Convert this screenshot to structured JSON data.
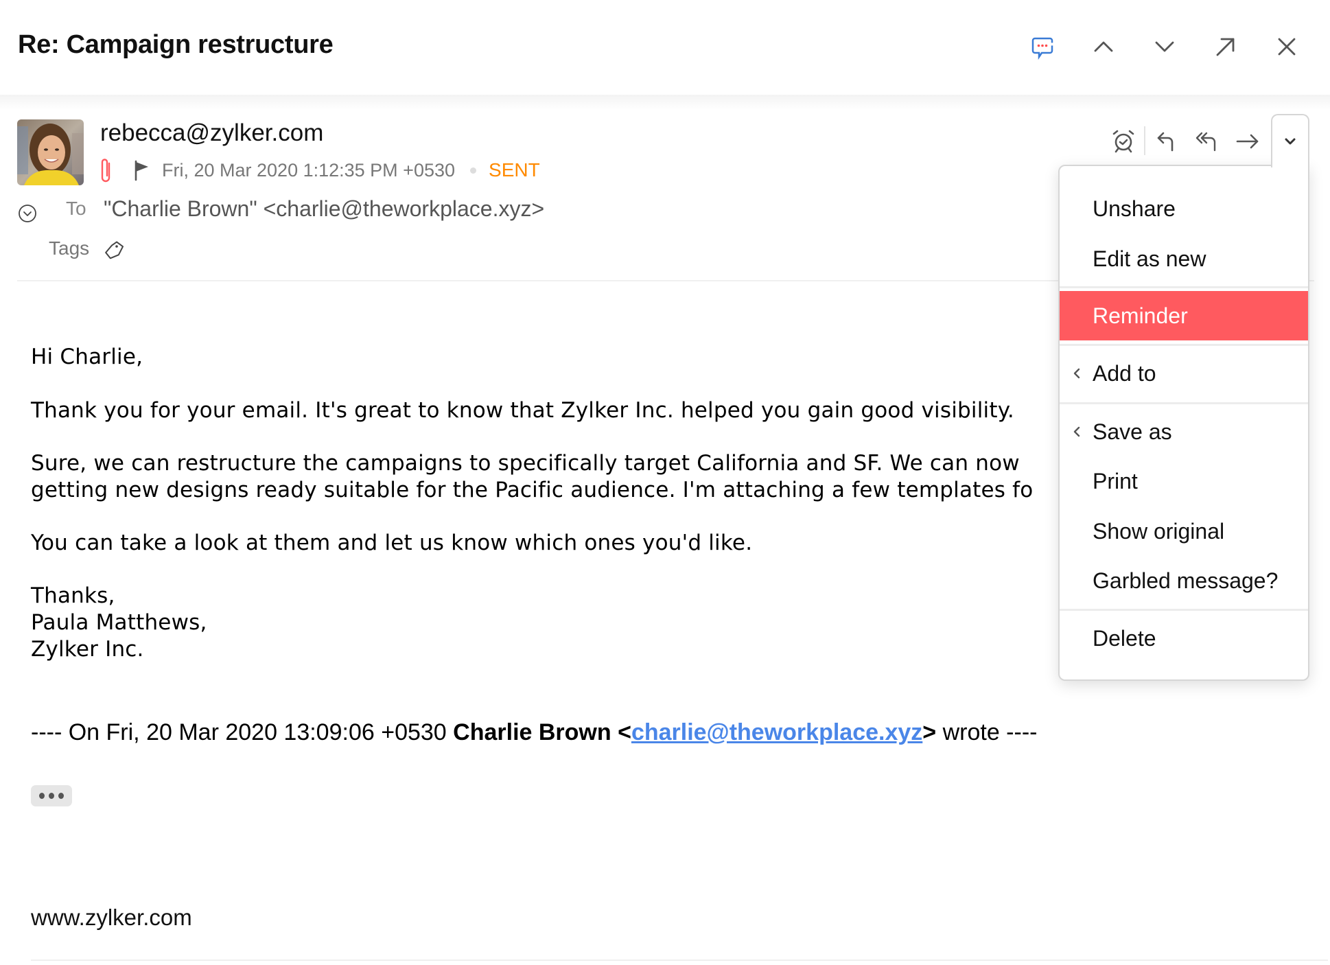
{
  "header": {
    "title": "Re: Campaign restructure",
    "icons": [
      "comments-icon",
      "previous-icon",
      "next-icon",
      "pop-out-icon",
      "close-icon"
    ]
  },
  "colors": {
    "accent_red": "#ff5a5f",
    "sent_orange": "#ff8a00",
    "link_blue": "#4a86e8",
    "comments_blue": "#3a7bd5"
  },
  "message": {
    "sender": "rebecca@zylker.com",
    "date": "Fri, 20 Mar 2020 1:12:35 PM +0530",
    "status": "SENT",
    "to_label": "To",
    "to_value": "\"Charlie Brown\" <charlie@theworkplace.xyz>",
    "tags_label": "Tags"
  },
  "toolbar": {
    "icons": [
      "reminder-alarm-icon",
      "reply-icon",
      "reply-all-icon",
      "forward-icon",
      "more-options-icon"
    ]
  },
  "menu": {
    "items": [
      {
        "label": "Unshare",
        "submenu": false,
        "active": false
      },
      {
        "label": "Edit as new",
        "submenu": false,
        "active": false
      },
      {
        "label": "Reminder",
        "submenu": false,
        "active": true
      },
      {
        "label": "Add to",
        "submenu": true,
        "active": false
      },
      {
        "label": "Save as",
        "submenu": true,
        "active": false
      },
      {
        "label": "Print",
        "submenu": false,
        "active": false
      },
      {
        "label": "Show original",
        "submenu": false,
        "active": false
      },
      {
        "label": "Garbled message?",
        "submenu": false,
        "active": false
      },
      {
        "label": "Delete",
        "submenu": false,
        "active": false
      }
    ]
  },
  "body": {
    "greeting": "Hi Charlie,",
    "para1": "Thank you for your email. It's great to know that Zylker Inc. helped you gain good visibility.",
    "para2_line1": "Sure, we can restructure the campaigns to specifically target California and SF. We can now",
    "para2_line2": "getting new designs ready suitable for the Pacific audience. I'm attaching a few templates fo",
    "para3": "You can take a look at them and let us know which ones you'd like.",
    "signoff": "Thanks,",
    "signature_name": "Paula Matthews,",
    "signature_company": "Zylker Inc.",
    "quote_prefix": "---- On Fri, 20 Mar 2020 13:09:06 +0530 ",
    "quote_author": "Charlie Brown <",
    "quote_email": "charlie@theworkplace.xyz",
    "quote_close": ">",
    "quote_suffix": " wrote ----",
    "footer_url": "www.zylker.com"
  }
}
